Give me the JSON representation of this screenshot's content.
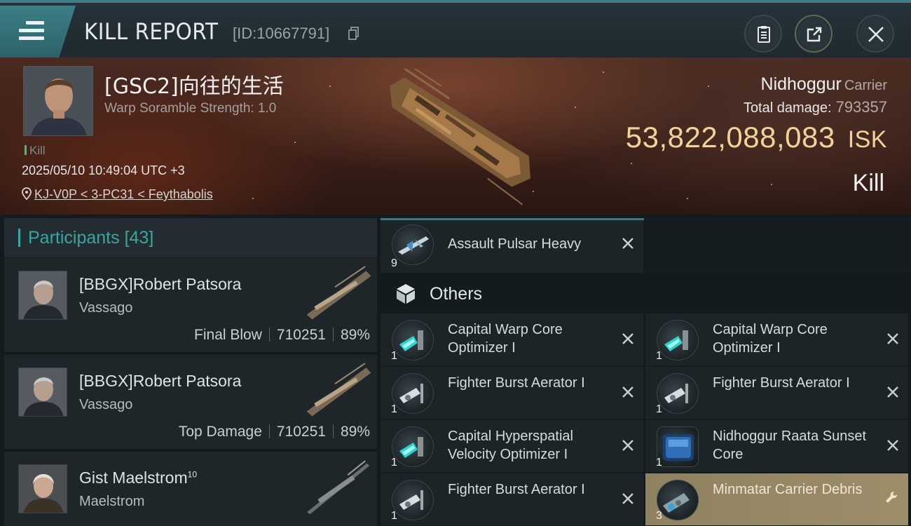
{
  "header": {
    "title": "KILL REPORT",
    "kill_id": "[ID:10667791]",
    "buttons": [
      "clipboard-icon",
      "share-icon",
      "close-icon"
    ]
  },
  "hero": {
    "pilot_name": "[GSC2]向往的生活",
    "scramble": "Warp Soramble Strength: 1.0",
    "kill_tag": "Kill",
    "datetime": "2025/05/10 10:49:04 UTC +3",
    "location": "KJ-V0P < 3-PC31 < Feythabolis",
    "ship_name": "Nidhoggur",
    "ship_class": "Carrier",
    "total_damage_label": "Total damage:",
    "total_damage": "793357",
    "isk_value": "53,822,088,083",
    "isk_unit": "ISK",
    "result": "Kill",
    "colors": {
      "accent": "#3c7f86",
      "isk": "#f3d29a"
    }
  },
  "participants": {
    "label": "Participants",
    "count": "[43]",
    "rows": [
      {
        "name": "[BBGX]Robert Patsora",
        "sup": "",
        "ship": "Vassago",
        "role": "Final Blow",
        "damage": "710251",
        "percent": "89%"
      },
      {
        "name": "[BBGX]Robert Patsora",
        "sup": "",
        "ship": "Vassago",
        "role": "Top Damage",
        "damage": "710251",
        "percent": "89%"
      },
      {
        "name": "Gist Maelstrom",
        "sup": "10",
        "ship": "Maelstrom",
        "role": "",
        "damage": "",
        "percent": ""
      }
    ]
  },
  "items": {
    "top": {
      "name": "Assault Pulsar Heavy",
      "qty": "9"
    },
    "others_label": "Others",
    "grid": [
      {
        "name": "Capital Warp Core Optimizer I",
        "qty": "1",
        "icon": "warp-core-optimizer-icon"
      },
      {
        "name": "Capital Warp Core Optimizer I",
        "qty": "1",
        "icon": "warp-core-optimizer-icon"
      },
      {
        "name": "Fighter Burst Aerator I",
        "qty": "1",
        "icon": "burst-aerator-icon"
      },
      {
        "name": "Fighter Burst Aerator I",
        "qty": "1",
        "icon": "burst-aerator-icon"
      },
      {
        "name": "Capital Hyperspatial Velocity Optimizer I",
        "qty": "1",
        "icon": "velocity-optimizer-icon"
      },
      {
        "name": "Nidhoggur Raata Sunset Core",
        "qty": "1",
        "icon": "ship-core-icon"
      },
      {
        "name": "Fighter Burst Aerator I",
        "qty": "1",
        "icon": "burst-aerator-icon"
      },
      {
        "name": "Minmatar Carrier Debris",
        "qty": "3",
        "icon": "debris-icon"
      }
    ]
  }
}
